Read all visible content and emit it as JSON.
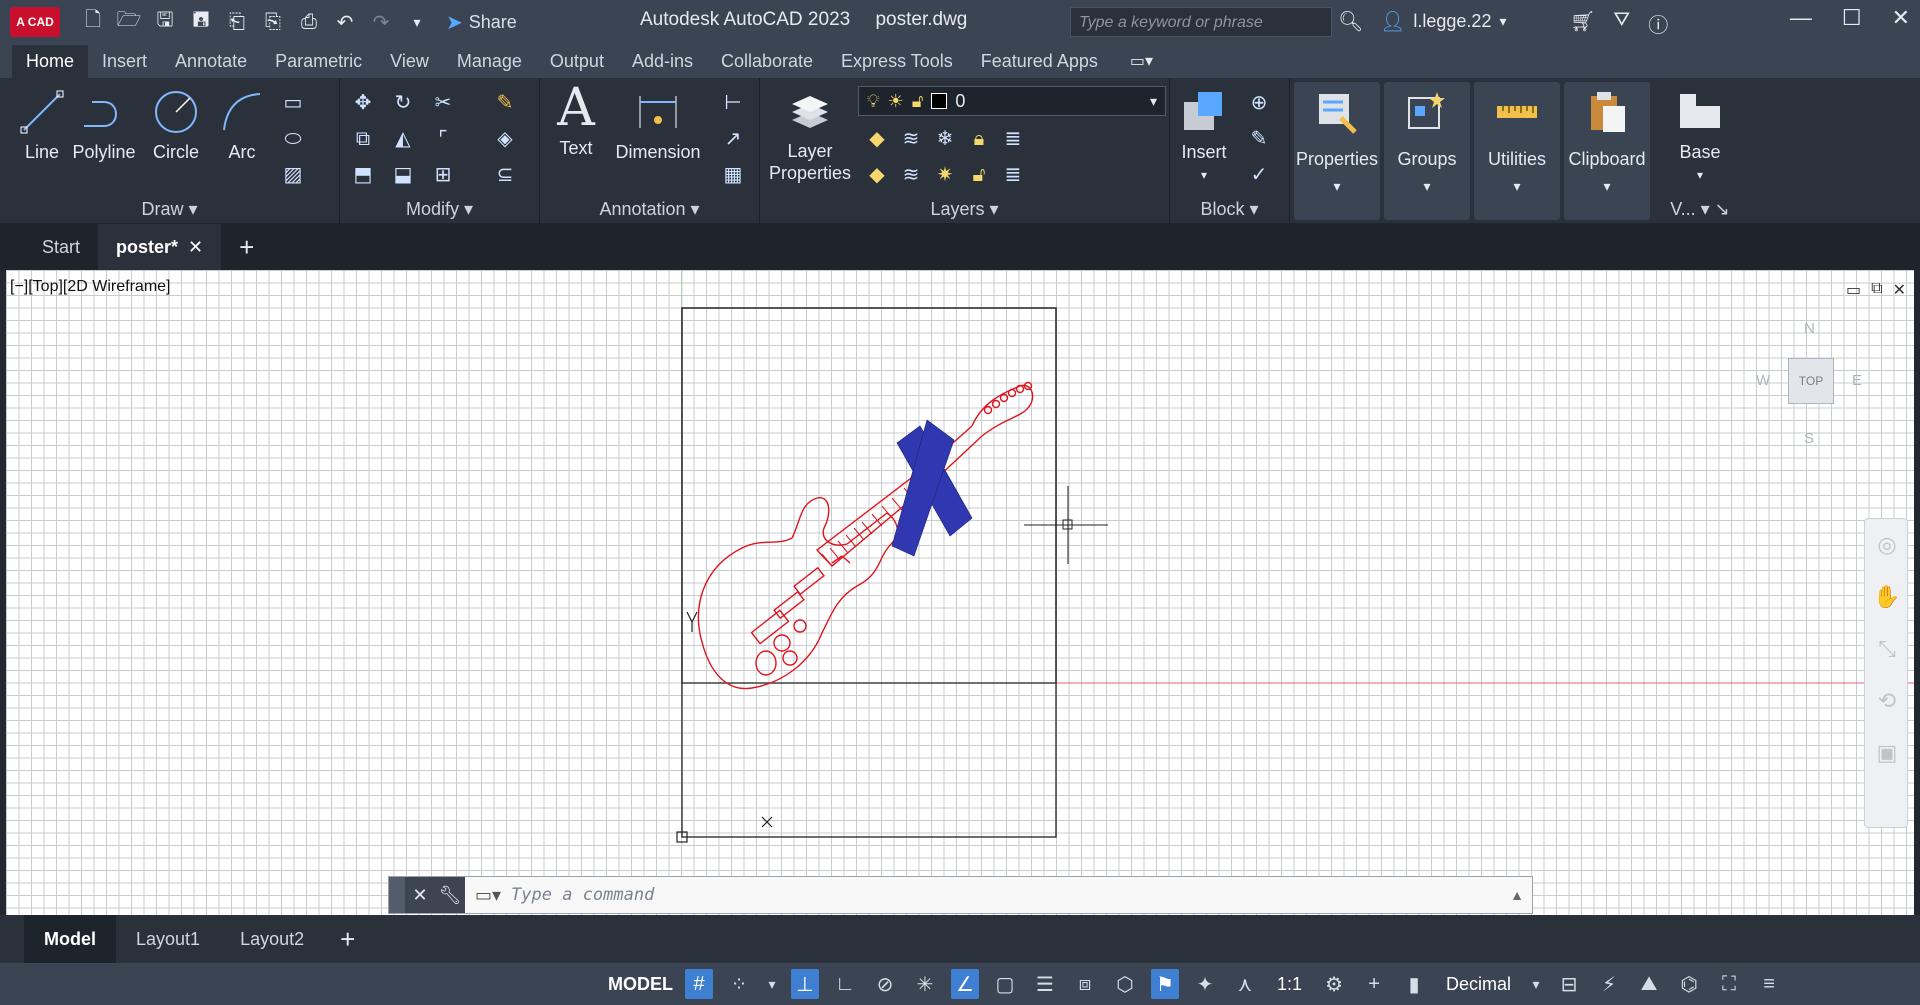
{
  "titlebar": {
    "logo": "A CAD",
    "app": "Autodesk AutoCAD 2023",
    "file": "poster.dwg",
    "share": "Share",
    "search_placeholder": "Type a keyword or phrase",
    "user": "l.legge.22"
  },
  "ribbon_tabs": [
    "Home",
    "Insert",
    "Annotate",
    "Parametric",
    "View",
    "Manage",
    "Output",
    "Add-ins",
    "Collaborate",
    "Express Tools",
    "Featured Apps"
  ],
  "ribbon": {
    "draw": {
      "line": "Line",
      "polyline": "Polyline",
      "circle": "Circle",
      "arc": "Arc",
      "label": "Draw"
    },
    "modify_label": "Modify",
    "annotation": {
      "text": "Text",
      "dimension": "Dimension",
      "label": "Annotation"
    },
    "layers": {
      "layer_properties": "Layer\nProperties",
      "current_layer": "0",
      "label": "Layers"
    },
    "block": {
      "insert": "Insert",
      "label": "Block"
    },
    "properties": "Properties",
    "groups": "Groups",
    "utilities": "Utilities",
    "clipboard": "Clipboard",
    "base": "Base",
    "view_label": "V..."
  },
  "doctabs": {
    "start": "Start",
    "poster": "poster*"
  },
  "viewport": {
    "label": "[−][Top][2D Wireframe]",
    "viewcube": {
      "face": "TOP",
      "n": "N",
      "s": "S",
      "e": "E",
      "w": "W"
    }
  },
  "command": {
    "placeholder": "Type a command"
  },
  "layout_tabs": {
    "model": "Model",
    "layout1": "Layout1",
    "layout2": "Layout2"
  },
  "statusbar": {
    "model": "MODEL",
    "scale": "1:1",
    "units": "Decimal"
  },
  "colors": {
    "accent": "#3f7fd1",
    "guitar": "#e0141c",
    "strap": "#2f38b0"
  }
}
